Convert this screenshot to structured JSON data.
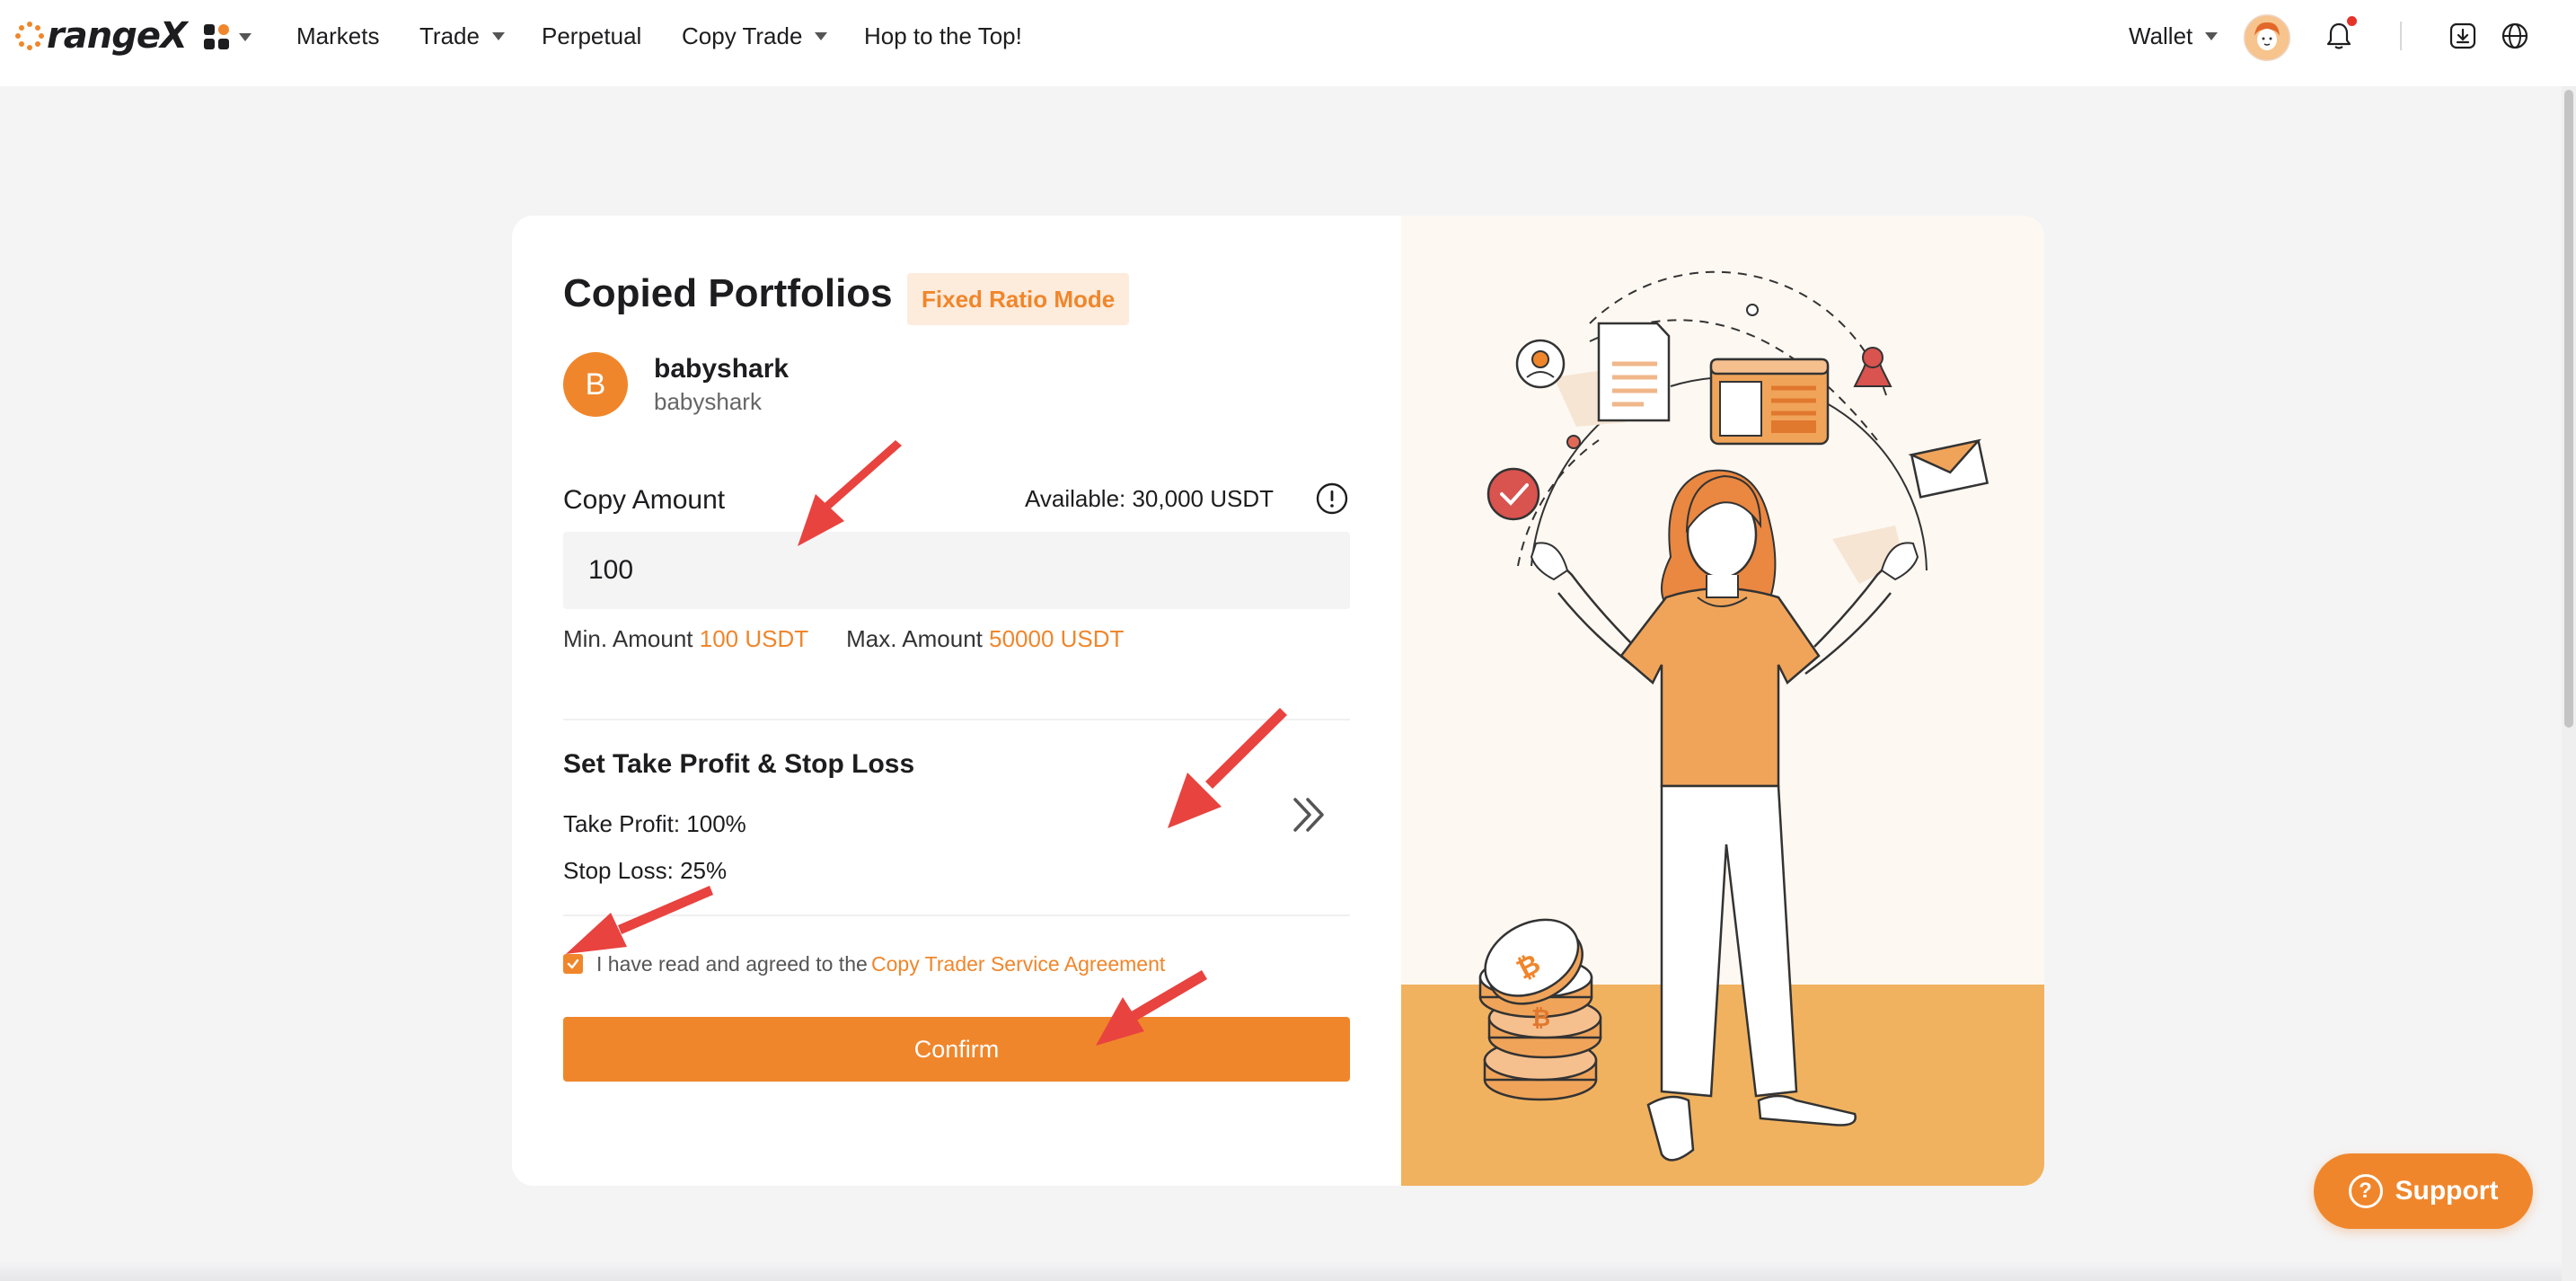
{
  "nav": {
    "logo_text": "rangeX",
    "items": [
      "Markets",
      "Trade",
      "Perpetual",
      "Copy Trade",
      "Hop to the Top!"
    ],
    "wallet": "Wallet"
  },
  "form": {
    "title": "Copied Portfolios",
    "mode": "Fixed Ratio Mode",
    "trader_initial": "B",
    "trader_name": "babyshark",
    "trader_handle": "babyshark",
    "copy_amount_label": "Copy Amount",
    "available": "Available: 30,000 USDT",
    "amount_value": "100",
    "min_label": "Min. Amount",
    "min_value": "100 USDT",
    "max_label": "Max. Amount",
    "max_value": "50000 USDT",
    "tpsl_title": "Set Take Profit & Stop Loss",
    "take_profit": "Take Profit: 100%",
    "stop_loss": "Stop Loss: 25%",
    "agree_text": "I have read and agreed to the",
    "agree_link": "Copy Trader Service Agreement",
    "confirm": "Confirm",
    "agreed": true
  },
  "support": {
    "label": "Support"
  },
  "colors": {
    "accent": "#f0862b",
    "annotation": "#e8433f"
  }
}
